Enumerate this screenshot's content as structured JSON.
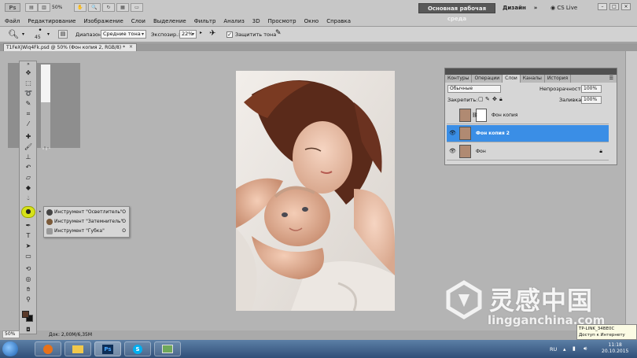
{
  "app": {
    "logo": "Ps",
    "zoom": "50%",
    "workspace_main": "Основная рабочая среда",
    "workspace_design": "Дизайн",
    "workspace_more": "»",
    "cs_live": "CS Live"
  },
  "menu": [
    "Файл",
    "Редактирование",
    "Изображение",
    "Слои",
    "Выделение",
    "Фильтр",
    "Анализ",
    "3D",
    "Просмотр",
    "Окно",
    "Справка"
  ],
  "options": {
    "brush_size": "45",
    "range_label": "Диапазон:",
    "range_value": "Средние тона",
    "exposure_label": "Экспозир.:",
    "exposure_value": "22%",
    "protect_label": "Защитить тона",
    "protect_checked": "✓"
  },
  "document": {
    "tab_title": "T1FeXjWiq4Fk.psd @ 50% (Фон копия 2, RGB/8) *",
    "close": "×",
    "zoom_box": "50%",
    "doc_size": "Док: 2,00M/6,35M"
  },
  "toolbar": {
    "collapse": "»",
    "tools": [
      "move",
      "marquee",
      "lasso",
      "quick-select",
      "crop",
      "eyedropper",
      "healing",
      "brush",
      "stamp",
      "history-brush",
      "eraser",
      "gradient",
      "blur",
      "dodge",
      "pen",
      "type",
      "path-select",
      "shape",
      "3d-rotate",
      "3d-orbit",
      "hand",
      "zoom"
    ]
  },
  "flyout": {
    "bullet": "•",
    "items": [
      {
        "label": "Инструмент \"Осветлитель\"",
        "key": "O"
      },
      {
        "label": "Инструмент \"Затемнитель\"",
        "key": "O"
      },
      {
        "label": "Инструмент \"Губка\"",
        "key": "O"
      }
    ]
  },
  "layers_panel": {
    "tabs": [
      "Контуры",
      "Операции",
      "Слои",
      "Каналы",
      "История"
    ],
    "active_tab": "Слои",
    "blend_mode": "Обычные",
    "opacity_label": "Непрозрачность:",
    "opacity_value": "100%",
    "lock_label": "Закрепить:",
    "fill_label": "Заливка:",
    "fill_value": "100%",
    "layers": [
      {
        "name": "Фон копия",
        "visible": false,
        "selected": false,
        "has_mask": true
      },
      {
        "name": "Фон копия 2",
        "visible": true,
        "selected": true,
        "has_mask": false
      },
      {
        "name": "Фон",
        "visible": true,
        "selected": false,
        "has_mask": false,
        "locked": true
      }
    ]
  },
  "watermark": {
    "chinese": "灵感中国",
    "url": "lingganchina.com"
  },
  "tooltip": {
    "line1": "TP-LINK_34BE0C",
    "line2": "Доступ к Интернету"
  },
  "taskbar": {
    "apps": [
      "firefox",
      "explorer",
      "Ps",
      "skype",
      "photo"
    ],
    "lang": "RU",
    "time": "11:18",
    "date": "20.10.2015"
  },
  "colors": {
    "accent_selected": "#3a8ee6",
    "dodge_highlight": "#d7e21a",
    "foreground": "#5a3a2a",
    "background": "#111111"
  }
}
